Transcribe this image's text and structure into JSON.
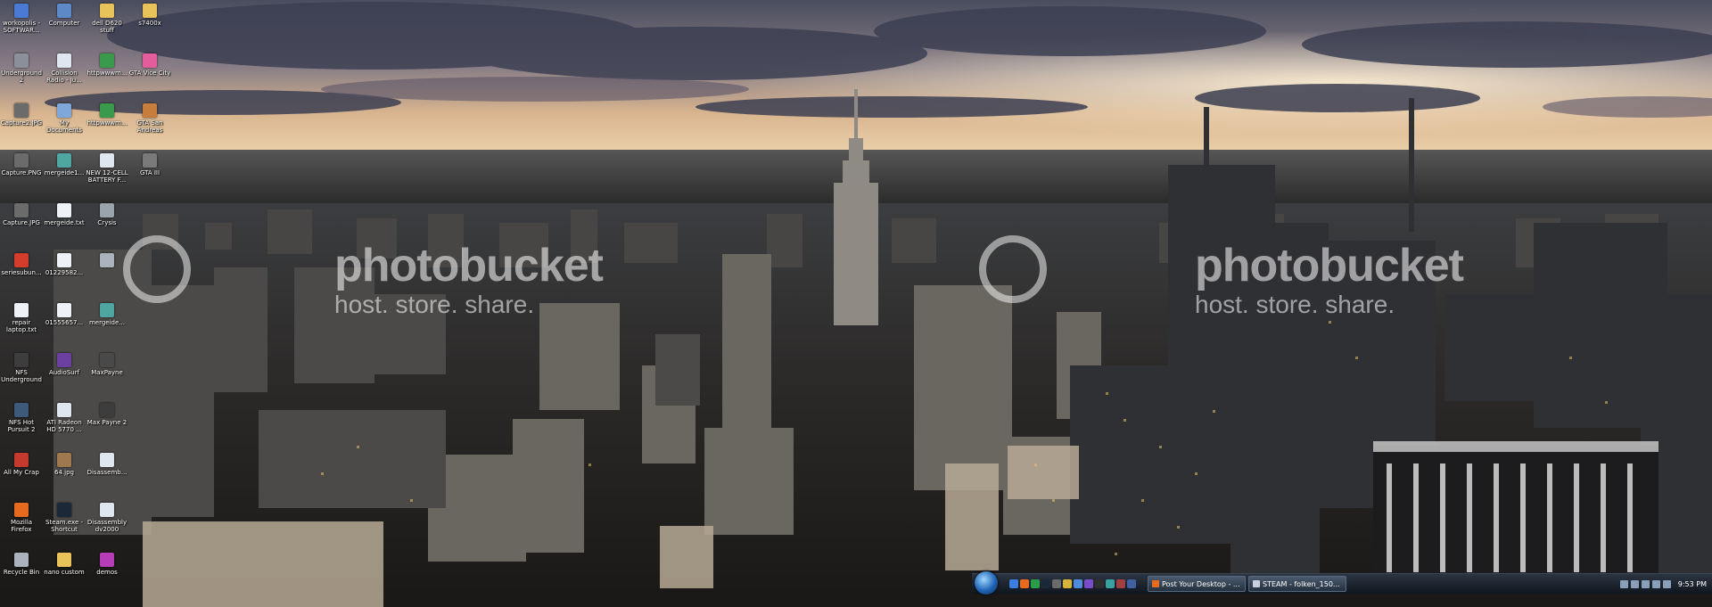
{
  "desktop": {
    "icons": [
      {
        "label": "workopolis - SOFTWAR...",
        "icon": "shortcut-icon",
        "color": "#4a7bd4"
      },
      {
        "label": "Computer",
        "icon": "computer-icon",
        "color": "#5d89c7"
      },
      {
        "label": "dell D620 stuff",
        "icon": "folder-icon",
        "color": "#e8c35a"
      },
      {
        "label": "s7400x",
        "icon": "folder-icon",
        "color": "#e8c35a"
      },
      {
        "label": "Underground 2",
        "icon": "game-icon",
        "color": "#8a8f99"
      },
      {
        "label": "Collision Radio - Ju...",
        "icon": "document-icon",
        "color": "#dfe6ef"
      },
      {
        "label": "httpwwwm...",
        "icon": "internet-shortcut-icon",
        "color": "#3a9a4c"
      },
      {
        "label": "GTA Vice City",
        "icon": "game-icon",
        "color": "#e35c9b"
      },
      {
        "label": "Capture2.JPG",
        "icon": "image-icon",
        "color": "#6b6b6b"
      },
      {
        "label": "My Documents",
        "icon": "documents-icon",
        "color": "#7fa8d8"
      },
      {
        "label": "httpwwwm...",
        "icon": "internet-shortcut-icon",
        "color": "#3a9a4c"
      },
      {
        "label": "GTA San Andreas",
        "icon": "game-icon",
        "color": "#c77d3c"
      },
      {
        "label": "Capture.PNG",
        "icon": "image-icon",
        "color": "#6b6b6b"
      },
      {
        "label": "mergeide1...",
        "icon": "registry-icon",
        "color": "#4fa6a0"
      },
      {
        "label": "NEW 12-CELL BATTERY F...",
        "icon": "document-icon",
        "color": "#dfe6ef"
      },
      {
        "label": "GTA III",
        "icon": "game-icon",
        "color": "#7a7a7a"
      },
      {
        "label": "Capture.JPG",
        "icon": "image-icon",
        "color": "#6b6b6b"
      },
      {
        "label": "mergeide.txt",
        "icon": "text-file-icon",
        "color": "#eef2f6"
      },
      {
        "label": "Crysis",
        "icon": "game-icon",
        "color": "#9aa4ad"
      },
      {
        "label": "",
        "icon": "blank-icon",
        "color": "transparent"
      },
      {
        "label": "seriesubun...",
        "icon": "game-icon",
        "color": "#d43c2c"
      },
      {
        "label": "01229582...",
        "icon": "text-file-icon",
        "color": "#eef2f6"
      },
      {
        "label": "",
        "icon": "shortcut-icon",
        "color": "#aab3bd"
      },
      {
        "label": "",
        "icon": "blank-icon",
        "color": "transparent"
      },
      {
        "label": "repair laptop.txt",
        "icon": "text-file-icon",
        "color": "#eef2f6"
      },
      {
        "label": "01555657...",
        "icon": "text-file-icon",
        "color": "#eef2f6"
      },
      {
        "label": "mergeide...",
        "icon": "registry-icon",
        "color": "#4fa6a0"
      },
      {
        "label": "",
        "icon": "blank-icon",
        "color": "transparent"
      },
      {
        "label": "NFS Underground",
        "icon": "game-icon",
        "color": "#3d3d3d"
      },
      {
        "label": "AudioSurf",
        "icon": "game-icon",
        "color": "#6b3fa0"
      },
      {
        "label": "MaxPayne",
        "icon": "game-icon",
        "color": "#494949"
      },
      {
        "label": "",
        "icon": "blank-icon",
        "color": "transparent"
      },
      {
        "label": "NFS Hot Pursuit 2",
        "icon": "game-icon",
        "color": "#3d5a7a"
      },
      {
        "label": "ATI Radeon HD 5770 ...",
        "icon": "document-icon",
        "color": "#dfe6ef"
      },
      {
        "label": "Max Payne 2",
        "icon": "game-icon",
        "color": "#3c3c3c"
      },
      {
        "label": "",
        "icon": "blank-icon",
        "color": "transparent"
      },
      {
        "label": "All My Crap",
        "icon": "shortcut-icon",
        "color": "#c43b2e"
      },
      {
        "label": "64.jpg",
        "icon": "image-icon",
        "color": "#a07850"
      },
      {
        "label": "Disassemb...",
        "icon": "image-icon",
        "color": "#dfe6ef"
      },
      {
        "label": "",
        "icon": "blank-icon",
        "color": "transparent"
      },
      {
        "label": "Mozilla Firefox",
        "icon": "firefox-icon",
        "color": "#e66a1f"
      },
      {
        "label": "Steam.exe - Shortcut",
        "icon": "steam-icon",
        "color": "#1b2838"
      },
      {
        "label": "Disassembly dv2000",
        "icon": "document-icon",
        "color": "#dfe6ef"
      },
      {
        "label": "",
        "icon": "blank-icon",
        "color": "transparent"
      },
      {
        "label": "Recycle Bin",
        "icon": "recycle-bin-icon",
        "color": "#aab3bd"
      },
      {
        "label": "nano custom",
        "icon": "folder-icon",
        "color": "#e8c35a"
      },
      {
        "label": "demos",
        "icon": "game-icon",
        "color": "#b63db8"
      }
    ]
  },
  "watermarks": [
    {
      "logo": "photobucket",
      "host": "host. store. share."
    },
    {
      "logo": "photobucket",
      "host": "host. store. share."
    }
  ],
  "taskbar": {
    "quick_launch": [
      "#3b7de0",
      "#e66a1f",
      "#2a9d4b",
      "#1b2838",
      "#6a6a6a",
      "#d7b23a",
      "#4c8cd8",
      "#7a4cc8",
      "#2f2f2f",
      "#3aa0a0",
      "#a04040",
      "#4060a0"
    ],
    "buttons": [
      {
        "label": "Post Your Desktop - ...",
        "icon_color": "#e66a1f"
      },
      {
        "label": "STEAM - folken_150...",
        "icon_color": "#c7d0dc"
      }
    ],
    "clock": "9:53 PM"
  }
}
